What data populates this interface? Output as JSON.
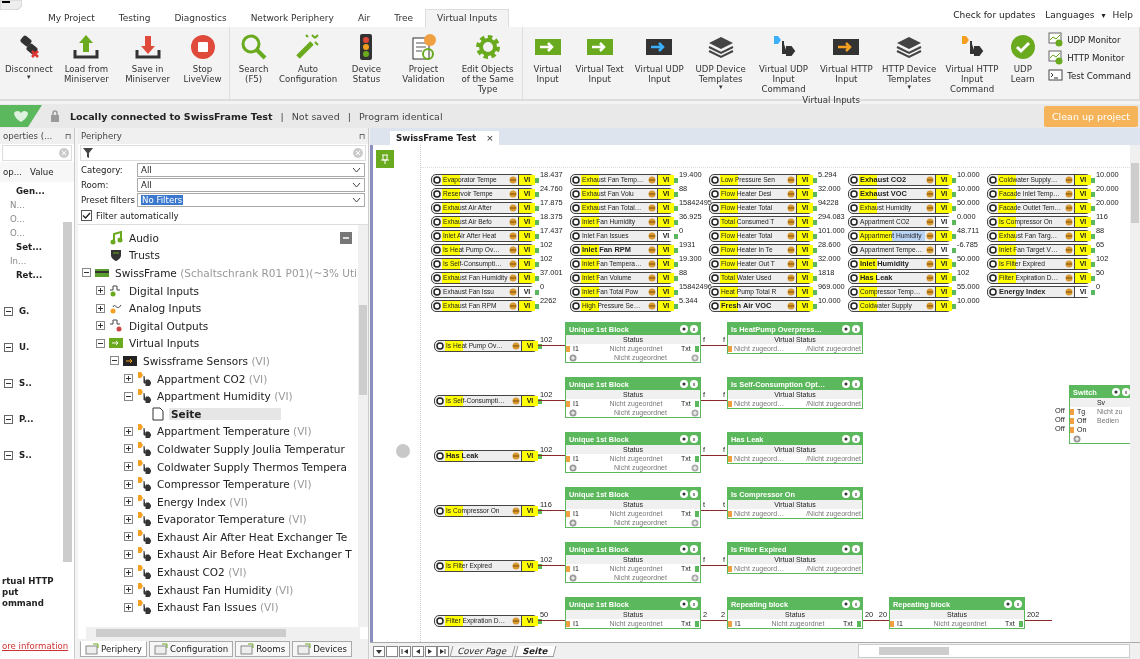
{
  "menu": {
    "tabs": [
      {
        "label": "My Project",
        "selected": false
      },
      {
        "label": "Testing",
        "selected": false
      },
      {
        "label": "Diagnostics",
        "selected": false
      },
      {
        "label": "Network Periphery",
        "selected": false
      },
      {
        "label": "Air",
        "selected": false
      },
      {
        "label": "Tree",
        "selected": false
      },
      {
        "label": "Virtual Inputs",
        "selected": true
      }
    ],
    "links": [
      "Check for updates",
      "Languages",
      "Help"
    ],
    "help_caret": "▾"
  },
  "ribbon": {
    "groups": [
      {
        "buttons": [
          {
            "kind": "disconnect",
            "label": "Disconnect",
            "caret": "▾"
          },
          {
            "kind": "upload",
            "label": "Load from Miniserver"
          },
          {
            "kind": "download",
            "label": "Save in Miniserver"
          },
          {
            "kind": "stop",
            "label": "Stop LiveView"
          }
        ]
      },
      {
        "buttons": [
          {
            "kind": "search",
            "label": "Search (F5)"
          },
          {
            "kind": "wand",
            "label": "Auto Configuration"
          },
          {
            "kind": "traffic",
            "label": "Device Status"
          },
          {
            "kind": "validation",
            "label": "Project Validation"
          },
          {
            "kind": "gear",
            "label": "Edit Objects of the Same Type"
          }
        ]
      },
      {
        "caption": "Virtual Inputs",
        "buttons": [
          {
            "kind": "vi-green",
            "label": "Virtual Input"
          },
          {
            "kind": "vi-green",
            "label": "Virtual Text Input"
          },
          {
            "kind": "vi-blue",
            "label": "Virtual UDP Input"
          },
          {
            "kind": "stack",
            "label": "UDP Device Templates",
            "caret": "▾"
          },
          {
            "kind": "cmd-blue",
            "label": "Virtual UDP Input Command"
          },
          {
            "kind": "vi-orange",
            "label": "Virtual HTTP Input"
          },
          {
            "kind": "stack",
            "label": "HTTP Device Templates",
            "caret": "▾"
          },
          {
            "kind": "cmd-orange",
            "label": "Virtual HTTP Input Command"
          },
          {
            "kind": "check",
            "label": "UDP Learn"
          }
        ],
        "small": [
          {
            "kind": "monitor",
            "label": "UDP Monitor"
          },
          {
            "kind": "monitor",
            "label": "HTTP Monitor"
          },
          {
            "kind": "terminal",
            "label": "Test Command"
          }
        ]
      }
    ]
  },
  "status_bar": {
    "connection": "Locally connected to SwissFrame Test",
    "parts": [
      "|",
      "Not saved",
      "|",
      "Program identical"
    ],
    "action": "Clean up project"
  },
  "properties": {
    "title": "operties (...",
    "pin": "⊓",
    "columns": [
      "op...",
      "Value"
    ],
    "rows": [
      {
        "kind": "heading",
        "text": "Gen..."
      },
      {
        "kind": "field",
        "text": "N..."
      },
      {
        "kind": "field",
        "text": "O..."
      },
      {
        "kind": "field",
        "text": "O..."
      },
      {
        "kind": "heading",
        "text": "Set..."
      },
      {
        "kind": "field",
        "text": "In..."
      },
      {
        "kind": "heading",
        "text": "Ret..."
      },
      {
        "kind": "group",
        "text": "G."
      },
      {
        "kind": "group",
        "text": "U."
      },
      {
        "kind": "group",
        "text": "S.."
      },
      {
        "kind": "group",
        "text": "P..."
      },
      {
        "kind": "group",
        "text": "S.."
      }
    ],
    "description": [
      "rtual HTTP",
      "put",
      "ommand"
    ],
    "link": "ore information"
  },
  "periphery": {
    "title": "Periphery",
    "filters": [
      {
        "label": "Category:",
        "value": "All"
      },
      {
        "label": "Room:",
        "value": "All"
      }
    ],
    "preset": {
      "label": "Preset filters",
      "value": "No Filters"
    },
    "auto_filter": {
      "label": "Filter automatically",
      "checked": true
    },
    "tree": [
      {
        "kind": "audio",
        "label": "Audio",
        "selected": false
      },
      {
        "kind": "trust",
        "label": "Trusts",
        "selected": false
      },
      {
        "kind": "device",
        "label": "SwissFrame",
        "suffix": "(Schaltschrank R01 P01)(~3% Util",
        "expanded": true,
        "selected": false,
        "children": [
          {
            "kind": "digital-in",
            "label": "Digital Inputs",
            "expanded": false,
            "selected": false
          },
          {
            "kind": "analog-in",
            "label": "Analog Inputs",
            "expanded": false,
            "selected": false
          },
          {
            "kind": "digital-out",
            "label": "Digital Outputs",
            "expanded": false,
            "selected": false
          },
          {
            "kind": "vi-group",
            "label": "Virtual Inputs",
            "expanded": true,
            "selected": false,
            "children": [
              {
                "kind": "vi-folder",
                "label": "Swissframe Sensors",
                "suffix": "(VI)",
                "expanded": true,
                "selected": false,
                "children": [
                  {
                    "kind": "vi",
                    "label": "Appartment CO2",
                    "suffix": "(VI)",
                    "expanded": false,
                    "selected": false
                  },
                  {
                    "kind": "vi",
                    "label": "Appartment Humidity",
                    "suffix": "(VI)",
                    "expanded": true,
                    "selected": false,
                    "children": [
                      {
                        "kind": "page",
                        "label": "Seite",
                        "selected": true
                      }
                    ]
                  },
                  {
                    "kind": "vi",
                    "label": "Appartment Temperature",
                    "suffix": "(VI)",
                    "expanded": false,
                    "selected": false
                  },
                  {
                    "kind": "vi",
                    "label": "Coldwater Supply Joulia Temperatur",
                    "expanded": false,
                    "selected": false
                  },
                  {
                    "kind": "vi",
                    "label": "Coldwater Supply Thermos Tempera",
                    "expanded": false,
                    "selected": false
                  },
                  {
                    "kind": "vi",
                    "label": "Compressor Temperature",
                    "suffix": "(VI)",
                    "expanded": false,
                    "selected": false
                  },
                  {
                    "kind": "vi",
                    "label": "Energy Index",
                    "suffix": "(VI)",
                    "expanded": false,
                    "selected": false
                  },
                  {
                    "kind": "vi",
                    "label": "Evaporator Temperature",
                    "suffix": "(VI)",
                    "expanded": false,
                    "selected": false
                  },
                  {
                    "kind": "vi",
                    "label": "Exhaust Air After Heat Exchanger Te",
                    "expanded": false,
                    "selected": false
                  },
                  {
                    "kind": "vi",
                    "label": "Exhaust Air Before Heat Exchanger T",
                    "expanded": false,
                    "selected": false
                  },
                  {
                    "kind": "vi",
                    "label": "Exhaust CO2",
                    "suffix": "(VI)",
                    "expanded": false,
                    "selected": false
                  },
                  {
                    "kind": "vi",
                    "label": "Exhaust Fan Humidity",
                    "suffix": "(VI)",
                    "expanded": false,
                    "selected": false
                  },
                  {
                    "kind": "vi",
                    "label": "Exhaust Fan Issues",
                    "suffix": "(VI)",
                    "expanded": false,
                    "selected": false
                  }
                ]
              }
            ]
          }
        ]
      }
    ],
    "tabs": [
      {
        "label": "Periphery",
        "selected": true
      },
      {
        "label": "Configuration",
        "selected": false
      },
      {
        "label": "Rooms",
        "selected": false
      },
      {
        "label": "Devices",
        "selected": false
      }
    ]
  },
  "document_tab": {
    "title": "SwissFrame Test",
    "close": "×"
  },
  "inputs": [
    [
      {
        "label": "Evaporator Tempe",
        "tag": "VI",
        "value": "18.437",
        "active": true,
        "large": false,
        "selected": false
      },
      {
        "label": "Reservoir Tempe",
        "tag": "VI",
        "value": "24.760",
        "active": true,
        "large": false,
        "selected": false
      },
      {
        "label": "Exhaust Air After",
        "tag": "VI",
        "value": "17.875",
        "active": true,
        "large": false,
        "selected": false
      },
      {
        "label": "Exhaust Air Befo",
        "tag": "VI",
        "value": "18.375",
        "active": true,
        "large": false,
        "selected": false
      },
      {
        "label": "Inlet Air After Heat",
        "tag": "VI",
        "value": "17.437",
        "active": true,
        "large": false,
        "selected": false
      },
      {
        "label": "Is Heat Pump Ov…",
        "tag": "VI",
        "value": "102",
        "active": true,
        "large": false,
        "selected": false
      },
      {
        "label": "Is Self-Consumpti…",
        "tag": "VI",
        "value": "102",
        "active": true,
        "large": false,
        "selected": false
      },
      {
        "label": "Exhaust Fan Humidity",
        "tag": "VI",
        "value": "37.001",
        "active": true,
        "large": false,
        "selected": false
      },
      {
        "label": "Exhaust Fan Issu",
        "tag": "VI",
        "value": "0",
        "active": false,
        "large": false,
        "selected": false
      },
      {
        "label": "Exhaust Fan RPM",
        "tag": "VI",
        "value": "2262",
        "active": true,
        "large": false,
        "selected": false
      }
    ],
    [
      {
        "label": "Exhaust Fan Temp…",
        "tag": "VI",
        "value": "19.400",
        "active": true,
        "large": false,
        "selected": false
      },
      {
        "label": "Exhaust Fan Volu",
        "tag": "VI",
        "value": "88",
        "active": true,
        "large": false,
        "selected": false
      },
      {
        "label": "Exhaust Fan Total…",
        "tag": "VI",
        "value": "15842495",
        "active": true,
        "large": false,
        "selected": false
      },
      {
        "label": "Inlet Fan Humidity",
        "tag": "VI",
        "value": "36.925",
        "active": true,
        "large": false,
        "selected": false
      },
      {
        "label": "Inlet Fan Issues",
        "tag": "VI",
        "value": "0",
        "active": false,
        "large": false,
        "selected": false
      },
      {
        "label": "Inlet Fan RPM",
        "tag": "VI",
        "value": "1931",
        "active": true,
        "large": true,
        "selected": false
      },
      {
        "label": "Inlet Fan Tempera…",
        "tag": "VI",
        "value": "19.300",
        "active": true,
        "large": false,
        "selected": false
      },
      {
        "label": "Inlet Fan Volume",
        "tag": "VI",
        "value": "88",
        "active": true,
        "large": false,
        "selected": false
      },
      {
        "label": "Inlet Fan Total Pow",
        "tag": "VI",
        "value": "15842496",
        "active": true,
        "large": false,
        "selected": false
      },
      {
        "label": "High Pressure Se…",
        "tag": "VI",
        "value": "5.344",
        "active": true,
        "large": false,
        "selected": false
      }
    ],
    [
      {
        "label": "Low Pressure Sen",
        "tag": "VI",
        "value": "5.294",
        "active": true,
        "large": false,
        "selected": false
      },
      {
        "label": "Flow Heater Desi",
        "tag": "VI",
        "value": "32.000",
        "active": true,
        "large": false,
        "selected": false
      },
      {
        "label": "Flow Heater Total",
        "tag": "VI",
        "value": "94228",
        "active": true,
        "large": false,
        "selected": false
      },
      {
        "label": "Total Consumed T",
        "tag": "VI",
        "value": "294.083",
        "active": true,
        "large": false,
        "selected": false
      },
      {
        "label": "Flow Heater Total",
        "tag": "VI",
        "value": "101.000",
        "active": true,
        "large": false,
        "selected": false
      },
      {
        "label": "Flow Heater In Te",
        "tag": "VI",
        "value": "28.600",
        "active": true,
        "large": false,
        "selected": false
      },
      {
        "label": "Flow Heater Out T",
        "tag": "VI",
        "value": "32.000",
        "active": true,
        "large": false,
        "selected": false
      },
      {
        "label": "Total Water Used",
        "tag": "VI",
        "value": "1818",
        "active": true,
        "large": false,
        "selected": false
      },
      {
        "label": "Heat Pump Total R",
        "tag": "VI",
        "value": "969.000",
        "active": true,
        "large": false,
        "selected": false
      },
      {
        "label": "Fresh Air VOC",
        "tag": "VI",
        "value": "10.000",
        "active": true,
        "large": true,
        "selected": false
      }
    ],
    [
      {
        "label": "Exhaust CO2",
        "tag": "VI",
        "value": "10.000",
        "active": true,
        "large": true,
        "selected": false
      },
      {
        "label": "Exhaust VOC",
        "tag": "VI",
        "value": "10.000",
        "active": true,
        "large": true,
        "selected": false
      },
      {
        "label": "Exhaust Humidity",
        "tag": "VI",
        "value": "50.000",
        "active": true,
        "large": false,
        "selected": false
      },
      {
        "label": "Appartment CO2",
        "tag": "VI",
        "value": "0.000",
        "active": false,
        "large": false,
        "selected": false
      },
      {
        "label": "Appartment Humidity",
        "tag": "VI",
        "value": "48.711",
        "active": true,
        "large": false,
        "selected": true
      },
      {
        "label": "Appartment Tempe…",
        "tag": "VI",
        "value": "-6.785",
        "active": false,
        "large": false,
        "selected": false
      },
      {
        "label": "Inlet Humidity",
        "tag": "VI",
        "value": "50.000",
        "active": true,
        "large": true,
        "selected": false
      },
      {
        "label": "Has Leak",
        "tag": "VI",
        "value": "102",
        "active": true,
        "large": true,
        "selected": false
      },
      {
        "label": "Compressor Temp…",
        "tag": "VI",
        "value": "55.000",
        "active": true,
        "large": false,
        "selected": false
      },
      {
        "label": "Coldwater Supply",
        "tag": "VI",
        "value": "10.000",
        "active": true,
        "large": false,
        "selected": false
      }
    ],
    [
      {
        "label": "Coldwater Supply…",
        "tag": "VI",
        "value": "10.000",
        "active": true,
        "large": false,
        "selected": false
      },
      {
        "label": "Facade Inlet Temp…",
        "tag": "VI",
        "value": "20.000",
        "active": true,
        "large": false,
        "selected": false
      },
      {
        "label": "Facade Outlet Tem…",
        "tag": "VI",
        "value": "20.000",
        "active": true,
        "large": false,
        "selected": false
      },
      {
        "label": "Is Compressor On",
        "tag": "VI",
        "value": "116",
        "active": true,
        "large": false,
        "selected": false
      },
      {
        "label": "Exhaust Fan Targ…",
        "tag": "VI",
        "value": "88",
        "active": true,
        "large": false,
        "selected": false
      },
      {
        "label": "Inlet Fan Target V…",
        "tag": "VI",
        "value": "65",
        "active": true,
        "large": false,
        "selected": false
      },
      {
        "label": "Is Filter Expired",
        "tag": "VI",
        "value": "102",
        "active": true,
        "large": false,
        "selected": false
      },
      {
        "label": "Filter Expiration D…",
        "tag": "VI",
        "value": "50",
        "active": true,
        "large": false,
        "selected": false
      },
      {
        "label": "Energy Index",
        "tag": "VI",
        "value": "0",
        "active": false,
        "large": true,
        "selected": false
      }
    ]
  ],
  "logic_rows": [
    {
      "input": {
        "label": "Is Heat Pump Ov…",
        "tag": "VI",
        "active": true,
        "large": false
      },
      "items": [
        {
          "kind": "wire",
          "labels": [
            "102"
          ]
        },
        {
          "kind": "block",
          "title": "Unique 1st Block",
          "status": "Status",
          "lines": [
            {
              "kind": "port",
              "left": "I1",
              "value": "Nicht zugeordnet",
              "right": "Txt"
            },
            {
              "kind": "add",
              "value": "Nicht zugeordnet"
            }
          ]
        },
        {
          "kind": "wire",
          "labels": [
            "f",
            "f"
          ]
        },
        {
          "kind": "output",
          "title": "Is HeatPump Overpress…",
          "status": "Virtual Status",
          "value": "Nicht zugeord…",
          "value2": "/Nicht zugeordnet"
        }
      ]
    },
    {
      "input": {
        "label": "Is Self-Consumpti…",
        "tag": "VI",
        "active": true,
        "large": false
      },
      "items": [
        {
          "kind": "wire",
          "labels": [
            "102"
          ]
        },
        {
          "kind": "block",
          "title": "Unique 1st Block",
          "status": "Status",
          "lines": [
            {
              "kind": "port",
              "left": "I1",
              "value": "Nicht zugeordnet",
              "right": "Txt"
            },
            {
              "kind": "add",
              "value": "Nicht zugeordnet"
            }
          ]
        },
        {
          "kind": "wire",
          "labels": [
            "f",
            "f"
          ]
        },
        {
          "kind": "output",
          "title": "Is Self-Consumption Opt…",
          "status": "Virtual Status",
          "value": "Nicht zugeord…",
          "value2": "/Nicht zugeordnet"
        }
      ]
    },
    {
      "input": {
        "label": "Has Leak",
        "tag": "VI",
        "active": true,
        "large": true
      },
      "items": [
        {
          "kind": "wire",
          "labels": [
            "102"
          ]
        },
        {
          "kind": "block",
          "title": "Unique 1st Block",
          "status": "Status",
          "lines": [
            {
              "kind": "port",
              "left": "I1",
              "value": "Nicht zugeordnet",
              "right": "Txt"
            },
            {
              "kind": "add",
              "value": "Nicht zugeordnet"
            }
          ]
        },
        {
          "kind": "wire",
          "labels": [
            "f",
            "f"
          ]
        },
        {
          "kind": "output",
          "title": "Has Leak",
          "status": "Virtual Status",
          "value": "Nicht zugeord…",
          "value2": "/Nicht zugeordnet"
        }
      ]
    },
    {
      "input": {
        "label": "Is Compressor On",
        "tag": "VI",
        "active": true,
        "large": false
      },
      "items": [
        {
          "kind": "wire",
          "labels": [
            "116"
          ]
        },
        {
          "kind": "block",
          "title": "Unique 1st Block",
          "status": "Status",
          "lines": [
            {
              "kind": "port",
              "left": "I1",
              "value": "Nicht zugeordnet",
              "right": "Txt"
            },
            {
              "kind": "add",
              "value": "Nicht zugeordnet"
            }
          ]
        },
        {
          "kind": "wire",
          "labels": [
            "t",
            "t"
          ]
        },
        {
          "kind": "output",
          "title": "Is Compressor On",
          "status": "Virtual Status",
          "value": "Nicht zugeord…",
          "value2": "/Nicht zugeordnet"
        }
      ]
    },
    {
      "input": {
        "label": "Is Filter Expired",
        "tag": "VI",
        "active": true,
        "large": false
      },
      "items": [
        {
          "kind": "wire",
          "labels": [
            "102"
          ]
        },
        {
          "kind": "block",
          "title": "Unique 1st Block",
          "status": "Status",
          "lines": [
            {
              "kind": "port",
              "left": "I1",
              "value": "Nicht zugeordnet",
              "right": "Txt"
            },
            {
              "kind": "add",
              "value": "Nicht zugeordnet"
            }
          ]
        },
        {
          "kind": "wire",
          "labels": [
            "f",
            "f"
          ]
        },
        {
          "kind": "output",
          "title": "Is Filter Expired",
          "status": "Virtual Status",
          "value": "Nicht zugeord…",
          "value2": "/Nicht zugeordnet"
        }
      ]
    },
    {
      "input": {
        "label": "Filter Expiration D…",
        "tag": "VI",
        "active": true,
        "large": false
      },
      "items": [
        {
          "kind": "wire",
          "labels": [
            "50"
          ]
        },
        {
          "kind": "block",
          "title": "Unique 1st Block",
          "status": "Status",
          "lines": [
            {
              "kind": "port",
              "left": "I1",
              "value": "Nicht zugeordnet",
              "right": "Txt"
            }
          ]
        },
        {
          "kind": "wire",
          "labels": [
            "2",
            "2"
          ]
        },
        {
          "kind": "block",
          "title": "Repeating block",
          "status": "Status",
          "lines": [
            {
              "kind": "port",
              "left": "I1",
              "value": "Nicht zugeordnet",
              "right": "Txt"
            }
          ]
        },
        {
          "kind": "wire",
          "labels": [
            "20",
            "20"
          ]
        },
        {
          "kind": "block",
          "title": "Repeating block",
          "status": "Status",
          "lines": [
            {
              "kind": "port",
              "left": "I1",
              "value": "Nicht zugeordnet",
              "right": "Txt"
            }
          ]
        },
        {
          "kind": "wire",
          "labels": [
            "202"
          ]
        }
      ]
    }
  ],
  "switch_block": {
    "title": "Switch",
    "status": "Sv",
    "inputs": [
      "Off",
      "Off",
      "Off"
    ],
    "lines": [
      {
        "kind": "port",
        "left": "Tg",
        "value": "Nicht zu"
      },
      {
        "kind": "port",
        "left": "Off",
        "value": "Bedien"
      },
      {
        "kind": "port",
        "left": "On"
      },
      {
        "kind": "add"
      }
    ]
  },
  "page_tabs": [
    {
      "label": "Cover Page",
      "selected": false
    },
    {
      "label": "Seite",
      "selected": true
    }
  ]
}
